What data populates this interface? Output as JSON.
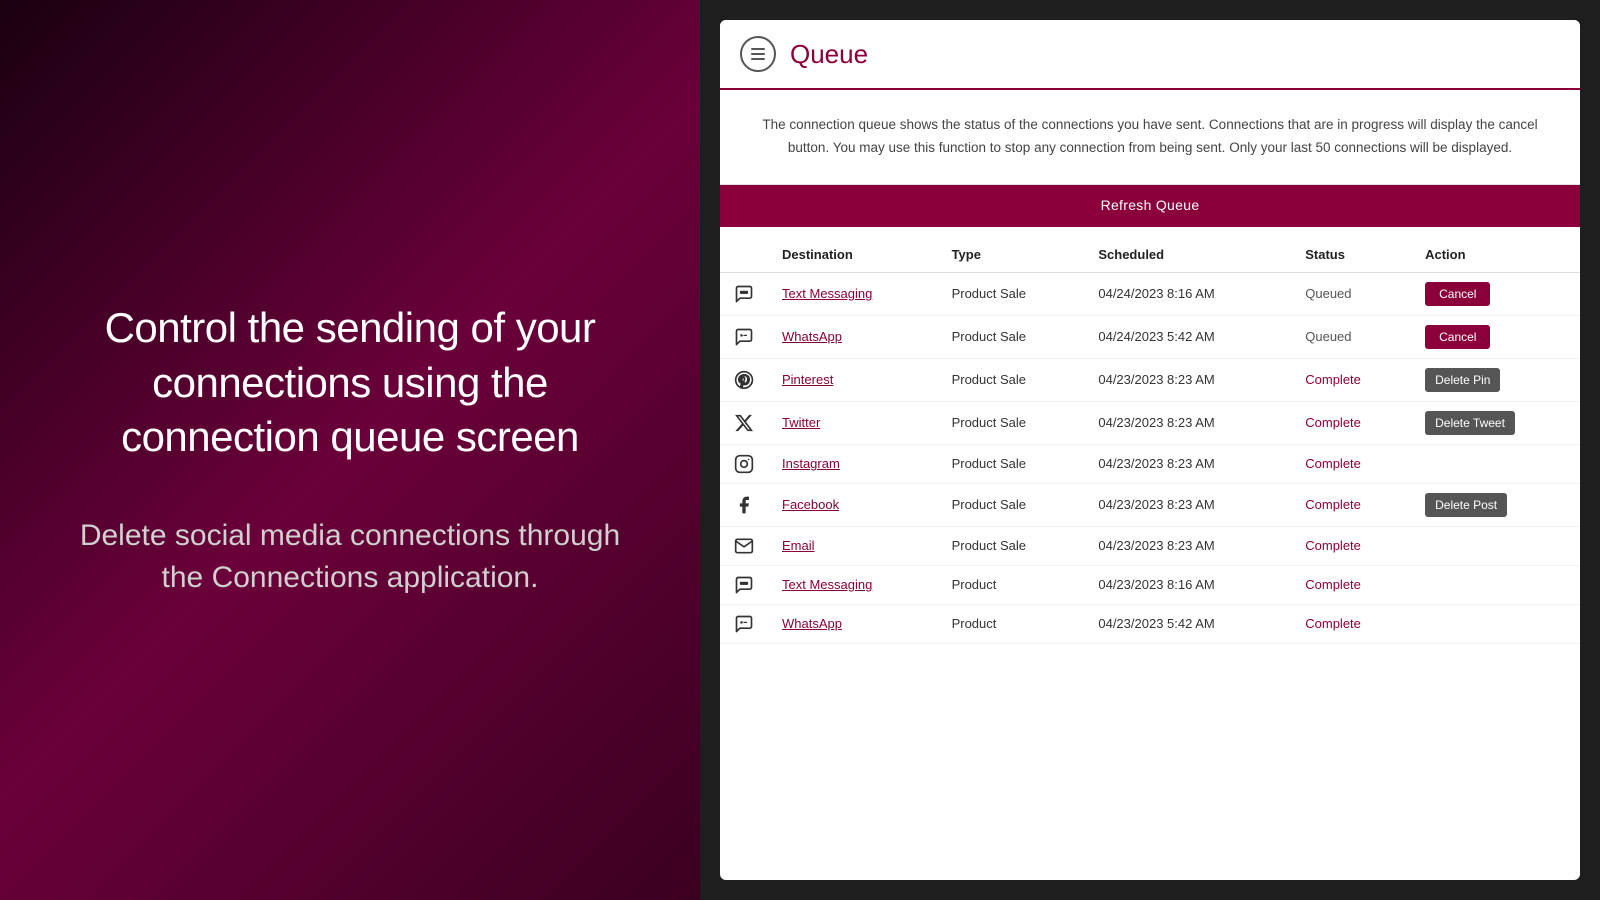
{
  "left": {
    "main_text": "Control the sending of your connections using the connection queue screen",
    "sub_text": "Delete social media connections through the Connections application."
  },
  "header": {
    "title": "Queue",
    "menu_icon_label": "menu"
  },
  "description": {
    "text": "The connection queue shows the status of the connections you have sent. Connections that are in progress will display the cancel button. You may use this function to stop any connection from being sent. Only your last 50 connections will be displayed."
  },
  "refresh_button": {
    "label": "Refresh Queue"
  },
  "table": {
    "columns": [
      "",
      "Destination",
      "Type",
      "Scheduled",
      "Status",
      "Action"
    ],
    "rows": [
      {
        "icon": "sms",
        "destination": "Text Messaging",
        "type": "Product Sale",
        "scheduled": "04/24/2023 8:16 AM",
        "status": "Queued",
        "status_class": "queued",
        "action": "Cancel",
        "action_type": "cancel"
      },
      {
        "icon": "whatsapp",
        "destination": "WhatsApp",
        "type": "Product Sale",
        "scheduled": "04/24/2023 5:42 AM",
        "status": "Queued",
        "status_class": "queued",
        "action": "Cancel",
        "action_type": "cancel"
      },
      {
        "icon": "pinterest",
        "destination": "Pinterest",
        "type": "Product Sale",
        "scheduled": "04/23/2023 8:23 AM",
        "status": "Complete",
        "status_class": "complete",
        "action": "Delete Pin",
        "action_type": "action"
      },
      {
        "icon": "twitter",
        "destination": "Twitter",
        "type": "Product Sale",
        "scheduled": "04/23/2023 8:23 AM",
        "status": "Complete",
        "status_class": "complete",
        "action": "Delete Tweet",
        "action_type": "action"
      },
      {
        "icon": "instagram",
        "destination": "Instagram",
        "type": "Product Sale",
        "scheduled": "04/23/2023 8:23 AM",
        "status": "Complete",
        "status_class": "complete",
        "action": "",
        "action_type": "none"
      },
      {
        "icon": "facebook",
        "destination": "Facebook",
        "type": "Product Sale",
        "scheduled": "04/23/2023 8:23 AM",
        "status": "Complete",
        "status_class": "complete",
        "action": "Delete Post",
        "action_type": "action"
      },
      {
        "icon": "email",
        "destination": "Email",
        "type": "Product Sale",
        "scheduled": "04/23/2023 8:23 AM",
        "status": "Complete",
        "status_class": "complete",
        "action": "",
        "action_type": "none"
      },
      {
        "icon": "sms",
        "destination": "Text Messaging",
        "type": "Product",
        "scheduled": "04/23/2023 8:16 AM",
        "status": "Complete",
        "status_class": "complete",
        "action": "",
        "action_type": "none"
      },
      {
        "icon": "whatsapp",
        "destination": "WhatsApp",
        "type": "Product",
        "scheduled": "04/23/2023 5:42 AM",
        "status": "Complete",
        "status_class": "complete",
        "action": "",
        "action_type": "none"
      }
    ]
  },
  "icons": {
    "sms": "💬",
    "whatsapp": "🔄",
    "pinterest": "📌",
    "twitter": "🐦",
    "instagram": "📷",
    "facebook": "🔵",
    "email": "✉"
  }
}
